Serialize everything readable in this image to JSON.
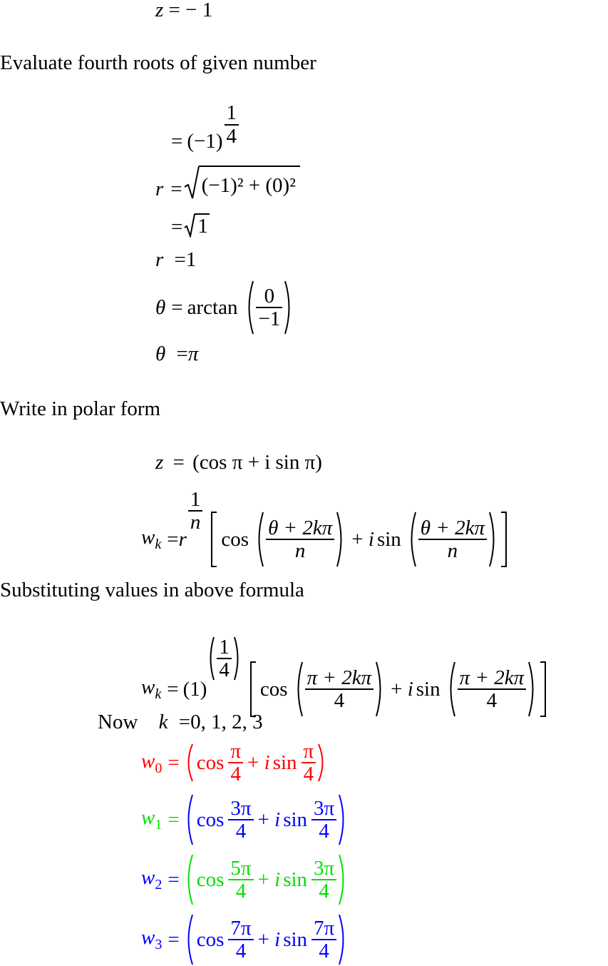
{
  "intro": {
    "lhs": "z",
    "rhs": "= − 1"
  },
  "headings": {
    "fourth_roots": "Evaluate fourth roots of given number",
    "polar_form": "Write in polar form",
    "substituting": "Substituting values in above formula"
  },
  "roots_section": {
    "power_base": "(−1)",
    "power_num": "1",
    "power_den": "4",
    "r_label": "r",
    "r_sqrt_expr": "(−1)² + (0)²",
    "r_sqrt_one": "1",
    "r_value": "1",
    "theta_label": "θ",
    "arctan": "arctan",
    "arctan_num": "0",
    "arctan_den": "−1",
    "theta_value": "π"
  },
  "polar_section": {
    "z_lhs": "z",
    "z_rhs": "(cos π + i sin π)",
    "wk_lhs": "w",
    "wk_sub": "k",
    "r": "r",
    "exp_num": "1",
    "exp_den": "n",
    "cos": "cos",
    "sin": "sin",
    "plus_i": "+ i",
    "arg_num": "θ + 2kπ",
    "arg_den": "n"
  },
  "substitution": {
    "wk_lhs": "w",
    "wk_sub": "k",
    "base": "(1)",
    "exp_num": "1",
    "exp_den": "4",
    "cos": "cos",
    "sin": "sin",
    "plus_i": "+ i",
    "arg_num": "π + 2kπ",
    "arg_den": "4"
  },
  "k_values": {
    "now": "Now",
    "k": "k",
    "values": "0, 1, 2, 3"
  },
  "roots": [
    {
      "label": "w",
      "sub": "0",
      "label_color": "#ff0000",
      "body_color": "#ff0000",
      "cos_num": "π",
      "cos_den": "4",
      "sin_num": "π",
      "sin_den": "4"
    },
    {
      "label": "w",
      "sub": "1",
      "label_color": "#00e000",
      "body_color": "#0000ff",
      "cos_num": "3π",
      "cos_den": "4",
      "sin_num": "3π",
      "sin_den": "4"
    },
    {
      "label": "w",
      "sub": "2",
      "label_color": "#0000ff",
      "body_color": "#00e000",
      "cos_num": "5π",
      "cos_den": "4",
      "sin_num": "3π",
      "sin_den": "4"
    },
    {
      "label": "w",
      "sub": "3",
      "label_color": "#0000ff",
      "body_color": "#0000ff",
      "cos_num": "7π",
      "cos_den": "4",
      "sin_num": "7π",
      "sin_den": "4"
    }
  ],
  "strings": {
    "equals": "=",
    "cos": "cos",
    "sin": "sin",
    "plus": "+",
    "i": "i"
  }
}
